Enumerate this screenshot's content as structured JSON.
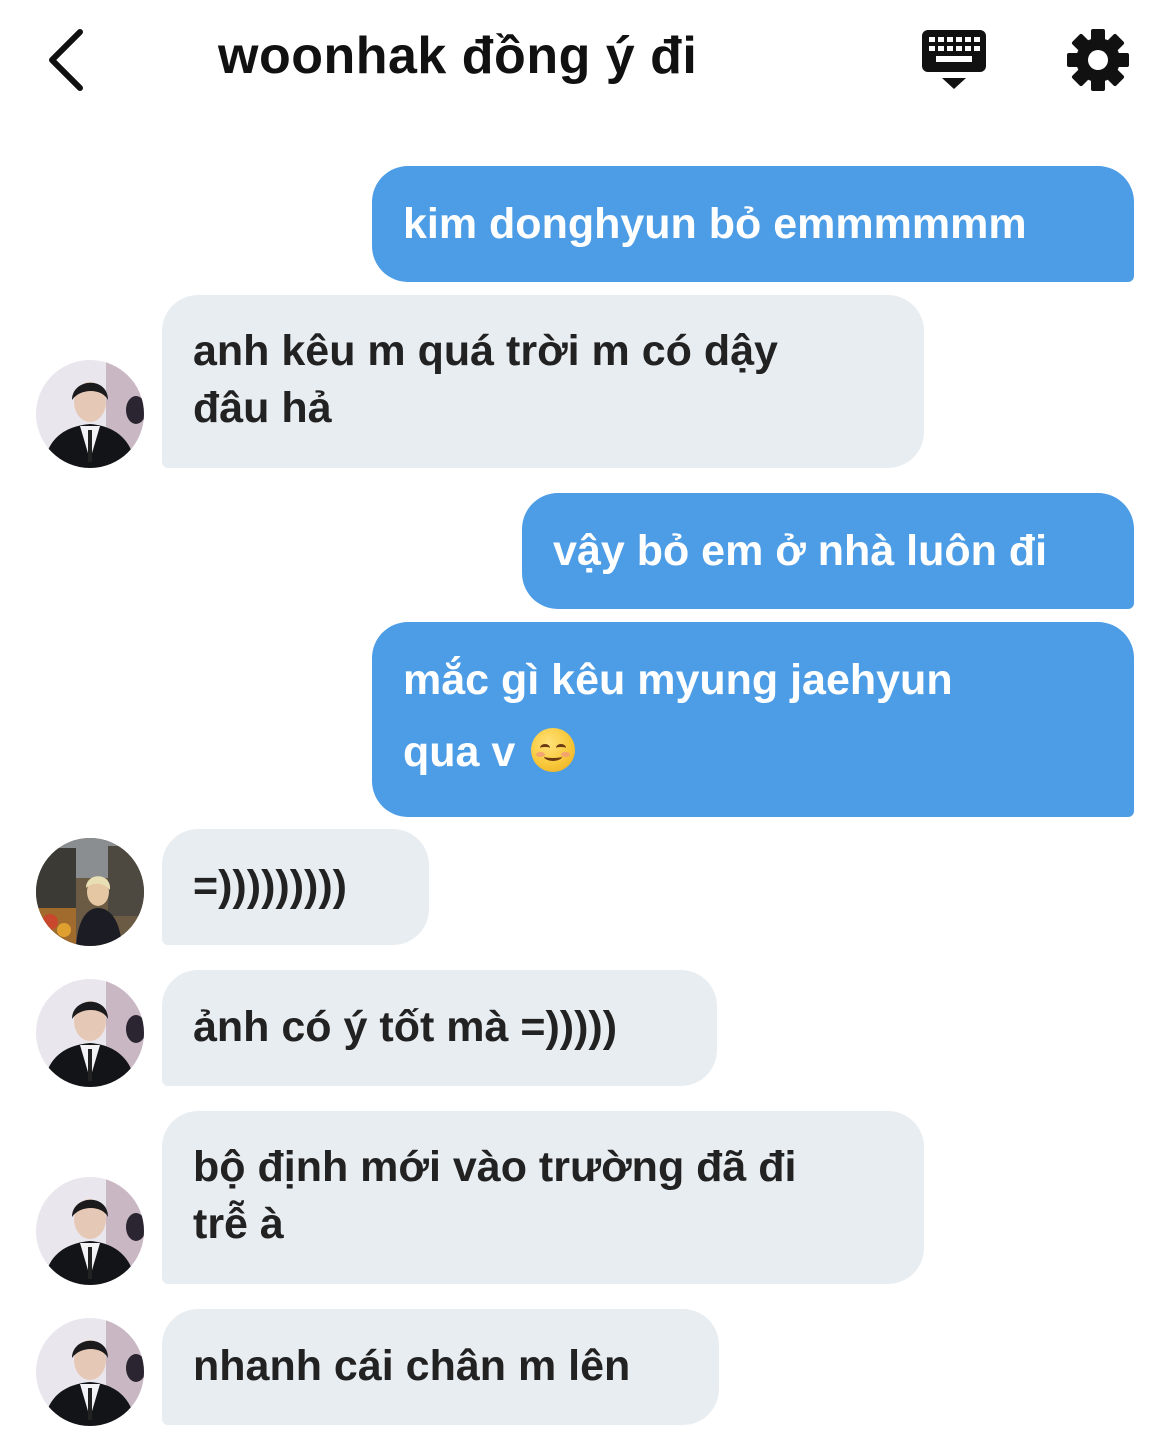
{
  "header": {
    "title": "woonhak đồng ý đi",
    "back_icon": "chevron-left-icon",
    "keyboard_icon": "keyboard-icon",
    "settings_icon": "gear-icon"
  },
  "colors": {
    "outgoing_bubble": "#4d9de6",
    "incoming_bubble": "#e8edf1",
    "outgoing_text": "#ffffff",
    "incoming_text": "#222222"
  },
  "messages": [
    {
      "sender": "me",
      "lines": [
        "kim donghyun bỏ emmmmmm"
      ]
    },
    {
      "sender": "them",
      "avatar": "avatar-1",
      "lines": [
        "anh kêu m quá trời m có dậy",
        "đâu hả"
      ]
    },
    {
      "sender": "me",
      "lines": [
        "vậy bỏ em ở nhà luôn đi"
      ]
    },
    {
      "sender": "me",
      "lines": [
        "mắc gì kêu myung jaehyun",
        "qua v"
      ],
      "emoji": "smiling-face-emoji"
    },
    {
      "sender": "them",
      "avatar": "avatar-2",
      "lines": [
        "=)))))))))"
      ]
    },
    {
      "sender": "them",
      "avatar": "avatar-1",
      "lines": [
        "ảnh có ý tốt mà =)))))"
      ]
    },
    {
      "sender": "them",
      "avatar": "avatar-1",
      "lines": [
        "bộ định mới vào trường đã đi",
        "trễ à"
      ]
    },
    {
      "sender": "them",
      "avatar": "avatar-1",
      "lines": [
        "nhanh cái chân m lên"
      ]
    }
  ]
}
